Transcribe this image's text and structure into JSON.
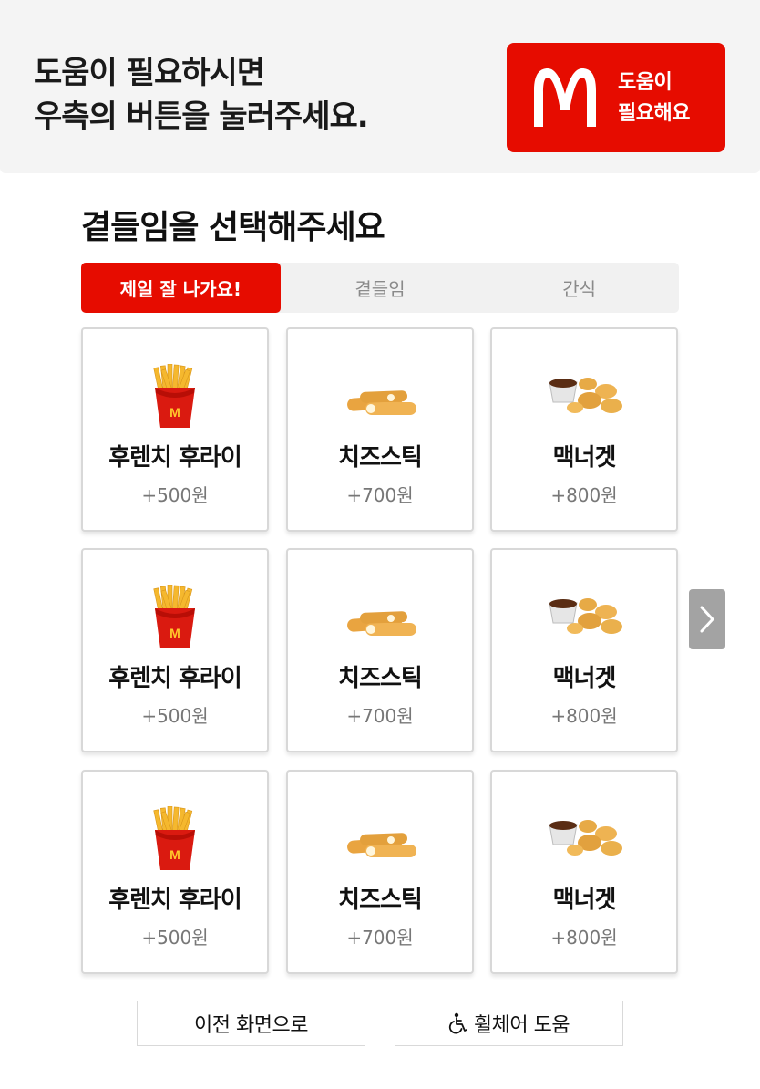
{
  "header": {
    "message_line1": "도움이 필요하시면",
    "message_line2": "우측의 버튼을 눌러주세요.",
    "help_button": {
      "line1": "도움이",
      "line2": "필요해요",
      "color": "#e60c00"
    }
  },
  "title": "곁들임을 선택해주세요",
  "tabs": [
    {
      "label": "제일 잘 나가요!",
      "active": true
    },
    {
      "label": "곁들임",
      "active": false
    },
    {
      "label": "간식",
      "active": false
    }
  ],
  "items": [
    {
      "name": "후렌치 후라이",
      "price": "+500원",
      "icon": "fries-icon"
    },
    {
      "name": "치즈스틱",
      "price": "+700원",
      "icon": "cheese-stick-icon"
    },
    {
      "name": "맥너겟",
      "price": "+800원",
      "icon": "nuggets-icon"
    },
    {
      "name": "후렌치 후라이",
      "price": "+500원",
      "icon": "fries-icon"
    },
    {
      "name": "치즈스틱",
      "price": "+700원",
      "icon": "cheese-stick-icon"
    },
    {
      "name": "맥너겟",
      "price": "+800원",
      "icon": "nuggets-icon"
    },
    {
      "name": "후렌치 후라이",
      "price": "+500원",
      "icon": "fries-icon"
    },
    {
      "name": "치즈스틱",
      "price": "+700원",
      "icon": "cheese-stick-icon"
    },
    {
      "name": "맥너겟",
      "price": "+800원",
      "icon": "nuggets-icon"
    }
  ],
  "footer": {
    "back_label": "이전 화면으로",
    "wheelchair_label": "휠체어 도움"
  },
  "colors": {
    "brand_red": "#e60c00",
    "logo_yellow": "#ffc72c"
  }
}
